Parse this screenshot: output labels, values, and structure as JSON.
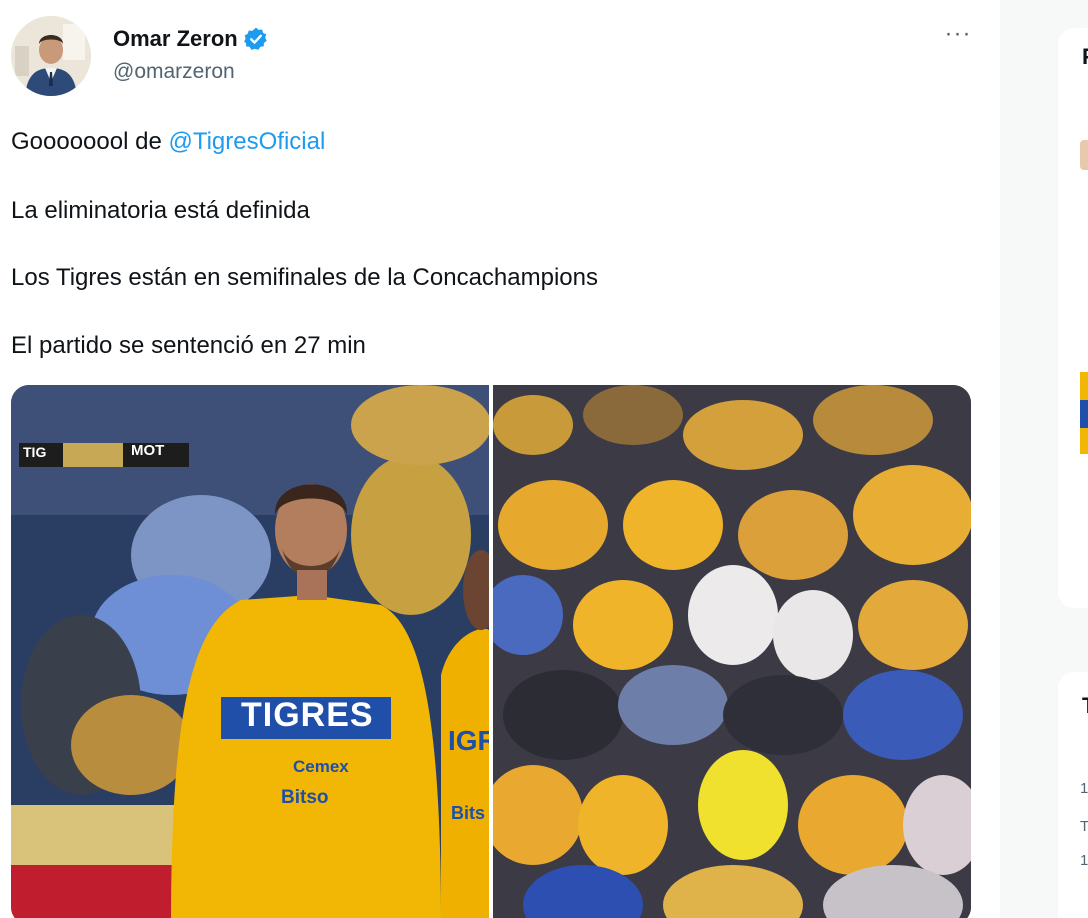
{
  "tweet": {
    "author": {
      "display_name": "Omar Zeron",
      "handle": "@omarzeron",
      "verified": true,
      "avatar_icon": "profile-photo"
    },
    "more_icon": "more-horizontal-icon",
    "more_label": "···",
    "lines": [
      {
        "prefix": "Goooooool de ",
        "mention": "@TigresOficial"
      },
      {
        "text": "La eliminatoria está definida"
      },
      {
        "text": "Los Tigres están en semifinales de la Concachampions"
      },
      {
        "text": "El partido se sentenció en 27 min"
      }
    ],
    "media": {
      "left_photo": {
        "scoreboard": {
          "home": "TIG",
          "away": "MOT"
        },
        "jersey_text": "TIGRES",
        "sponsor_1": "Cemex",
        "sponsor_2": "Bitso",
        "jersey_text_partial": "IGR",
        "sponsor_partial": "Bits"
      },
      "right_photo": {
        "subject": "stadium-crowd"
      }
    }
  },
  "sidebar": {
    "letters": [
      "F",
      "T"
    ],
    "small_lines": [
      "1",
      "T",
      "1"
    ]
  },
  "colors": {
    "link": "#1d9bf0",
    "verified": "#1d9bf0",
    "text": "#0f1419",
    "secondary": "#536471",
    "jersey": "#f2b705"
  }
}
